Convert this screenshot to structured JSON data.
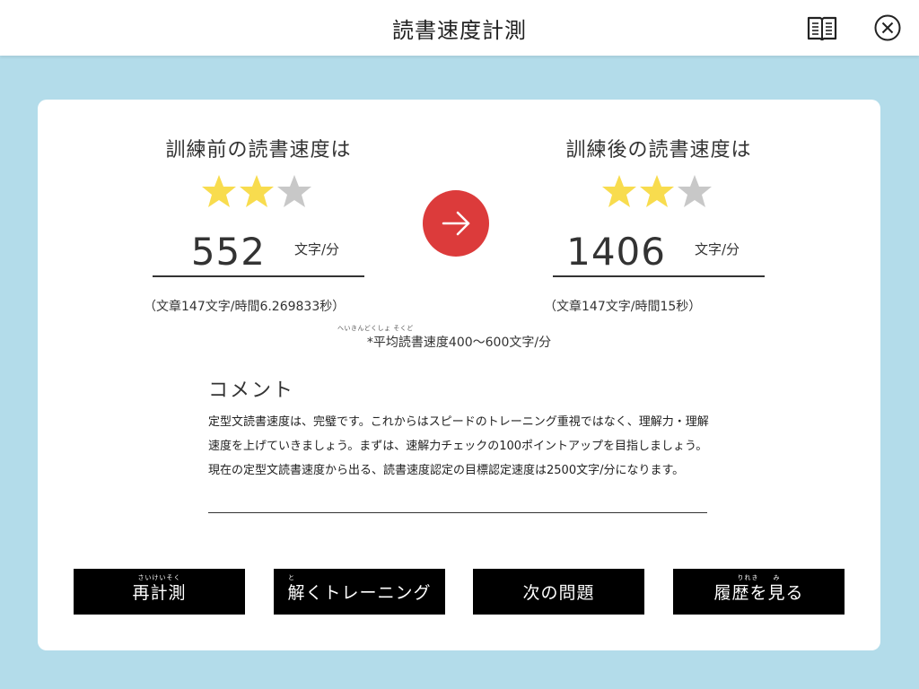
{
  "header": {
    "title": "読書速度計測",
    "icons": {
      "book": "book-open-icon",
      "close": "close-circle-icon"
    }
  },
  "before": {
    "title": "訓練前の読書速度は",
    "stars_filled": 2,
    "stars_total": 3,
    "speed": "552",
    "unit": "文字/分",
    "detail": "（文章147文字/時間6.269833秒）"
  },
  "after": {
    "title": "訓練後の読書速度は",
    "stars_filled": 2,
    "stars_total": 3,
    "speed": "1406",
    "unit": "文字/分",
    "detail": "（文章147文字/時間15秒）"
  },
  "average": {
    "text": "*平均読書速度400～600文字/分",
    "ruby": "へいきんどくしょ そくど"
  },
  "comment": {
    "heading": "コメント",
    "body": "定型文読書速度は、完璧です。これからはスピードのトレーニング重視ではなく、理解力・理解速度を上げていきましょう。まずは、速解力チェックの100ポイントアップを目指しましょう。現在の定型文読書速度から出る、読書速度認定の目標認定速度は2500文字/分になります。"
  },
  "buttons": [
    {
      "label": "再計測",
      "ruby": "さいけいそく"
    },
    {
      "label": "解くトレーニング",
      "ruby": "と"
    },
    {
      "label": "次の問題",
      "ruby": ""
    },
    {
      "label": "履歴を見る",
      "ruby": "りれき　　み"
    }
  ],
  "colors": {
    "background": "#b3dcea",
    "star_filled": "#f8dc4e",
    "star_empty": "#c8c8c8",
    "arrow_button": "#dc3b3b",
    "button_bg": "#000000"
  }
}
